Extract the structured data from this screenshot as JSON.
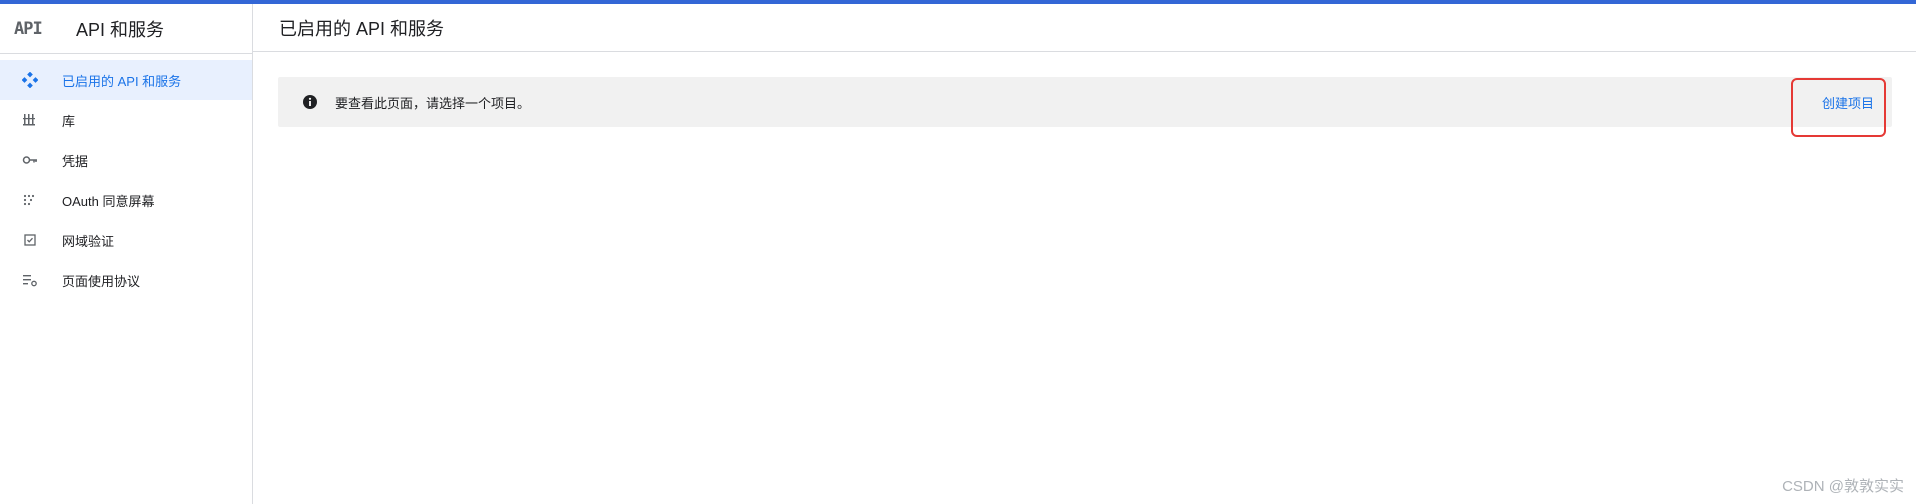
{
  "app": {
    "logo_text": "API",
    "title": "API 和服务"
  },
  "sidebar": {
    "items": [
      {
        "label": "已启用的 API 和服务",
        "icon": "api-diamond-icon",
        "active": true
      },
      {
        "label": "库",
        "icon": "library-icon",
        "active": false
      },
      {
        "label": "凭据",
        "icon": "key-icon",
        "active": false
      },
      {
        "label": "OAuth 同意屏幕",
        "icon": "consent-dots-icon",
        "active": false
      },
      {
        "label": "网域验证",
        "icon": "checkbox-icon",
        "active": false
      },
      {
        "label": "页面使用协议",
        "icon": "settings-list-icon",
        "active": false
      }
    ]
  },
  "page": {
    "title": "已启用的 API 和服务"
  },
  "banner": {
    "icon": "info-icon",
    "message": "要查看此页面，请选择一个项目。",
    "action_label": "创建项目"
  },
  "watermark": "CSDN @敦敦实实",
  "colors": {
    "accent": "#1a73e8",
    "top_bar": "#3367d6",
    "active_bg": "#e8f0fe",
    "highlight": "#e53935"
  }
}
